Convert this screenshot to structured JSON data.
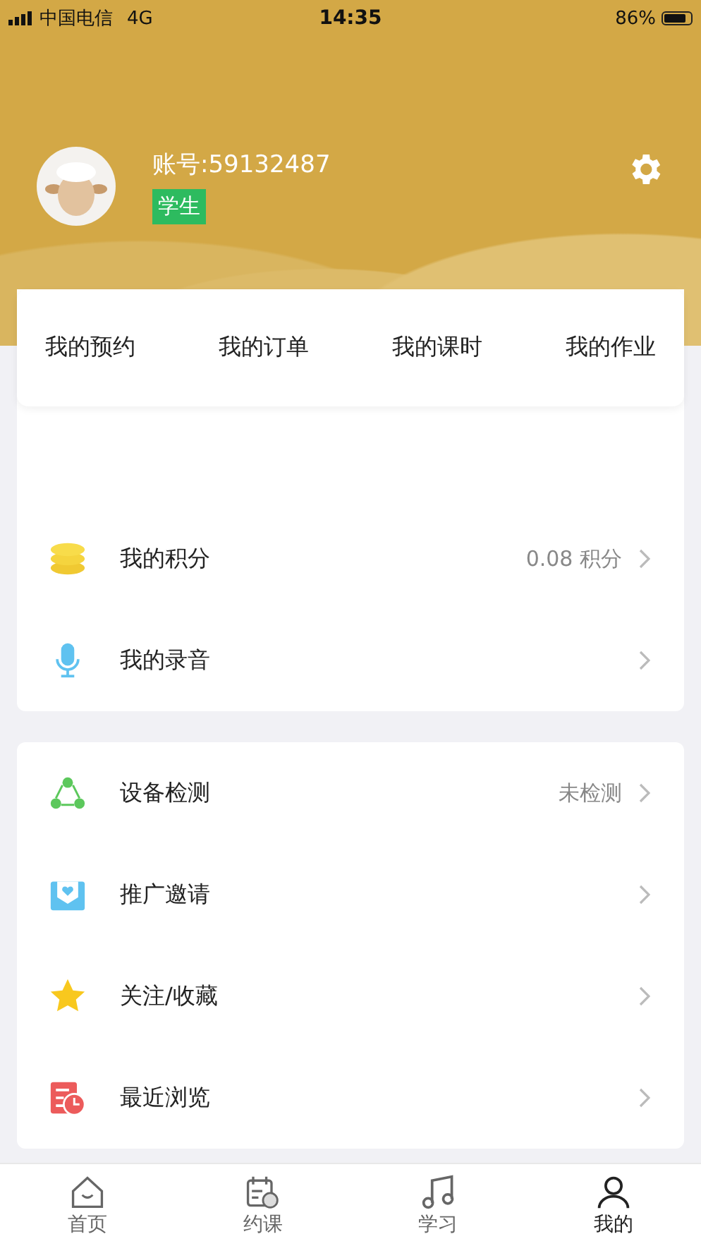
{
  "status_bar": {
    "carrier": "中国电信",
    "network": "4G",
    "time": "14:35",
    "battery": "86%"
  },
  "profile": {
    "account": "账号:59132487",
    "role": "学生"
  },
  "shortcuts": [
    "我的预约",
    "我的订单",
    "我的课时",
    "我的作业"
  ],
  "sections": [
    [
      {
        "kind": "coins",
        "label": "我的积分",
        "value": "0.08 积分"
      },
      {
        "kind": "mic",
        "label": "我的录音"
      }
    ],
    [
      {
        "kind": "nodes",
        "label": "设备检测",
        "value": "未检测"
      },
      {
        "kind": "envelope",
        "label": "推广邀请"
      },
      {
        "kind": "star",
        "label": "关注/收藏"
      },
      {
        "kind": "history",
        "label": "最近浏览"
      }
    ]
  ],
  "tabs": [
    {
      "kind": "home",
      "label": "首页",
      "selected": false
    },
    {
      "kind": "calendar",
      "label": "约课",
      "selected": false
    },
    {
      "kind": "music",
      "label": "学习",
      "selected": false
    },
    {
      "kind": "person",
      "label": "我的",
      "selected": true
    }
  ]
}
